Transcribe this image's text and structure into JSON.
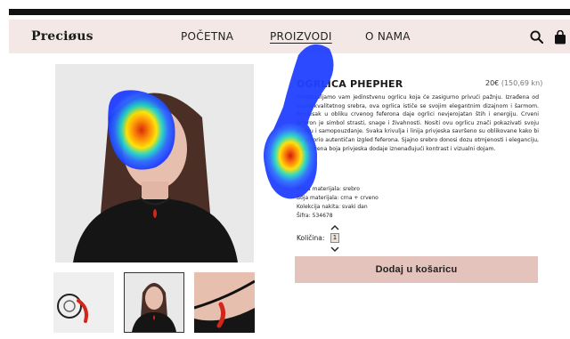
{
  "brand": "Preciøus",
  "nav": {
    "items": [
      "POČETNA",
      "PROIZVODI",
      "O NAMA"
    ],
    "search_icon": "search-icon",
    "cart_icon": "shopping-bag-icon"
  },
  "product": {
    "title": "OGRLICA PHEPHER",
    "price": "20€",
    "price_alt": "(150,69 kn)",
    "description": "Predstavljamo vam jedinstvenu ogrlicu koja će zasigurno privući pažnju. Izrađena od visokokvalitetnog srebra, ova ogrlica ističe se svojim elegantnim dizajnom i šarmom. Privjesak u obliku crvenog feferona daje ogrlici nevjerojatan štih i energiju. Crveni feferon je simbol strasti, snage i živahnosti. Nositi ovu ogrlicu znači pokazivati svoju snagu i samopouzdanje. Svaka krivulja i linija privjeska savršeno su oblikovane kako bi se stvorio autentičan izgled feferona. Sjajno srebro donosi dozu otmjenosti i eleganciju, dok crvena boja privjeska dodaje iznenađujući kontrast i vizualni dojam.",
    "specs": [
      "Vrsta materijala: srebro",
      "Boja materijala: crna + crveno",
      "Kolekcija nakita: svaki dan",
      "Šifra: 534678"
    ],
    "quantity_label": "Količina:",
    "quantity_value": "1",
    "add_to_cart": "Dodaj u košaricu"
  },
  "colors": {
    "nav_bg": "#f3e8e5",
    "cart_button": "#e3c3bb",
    "pepper_red": "#d2261b"
  }
}
